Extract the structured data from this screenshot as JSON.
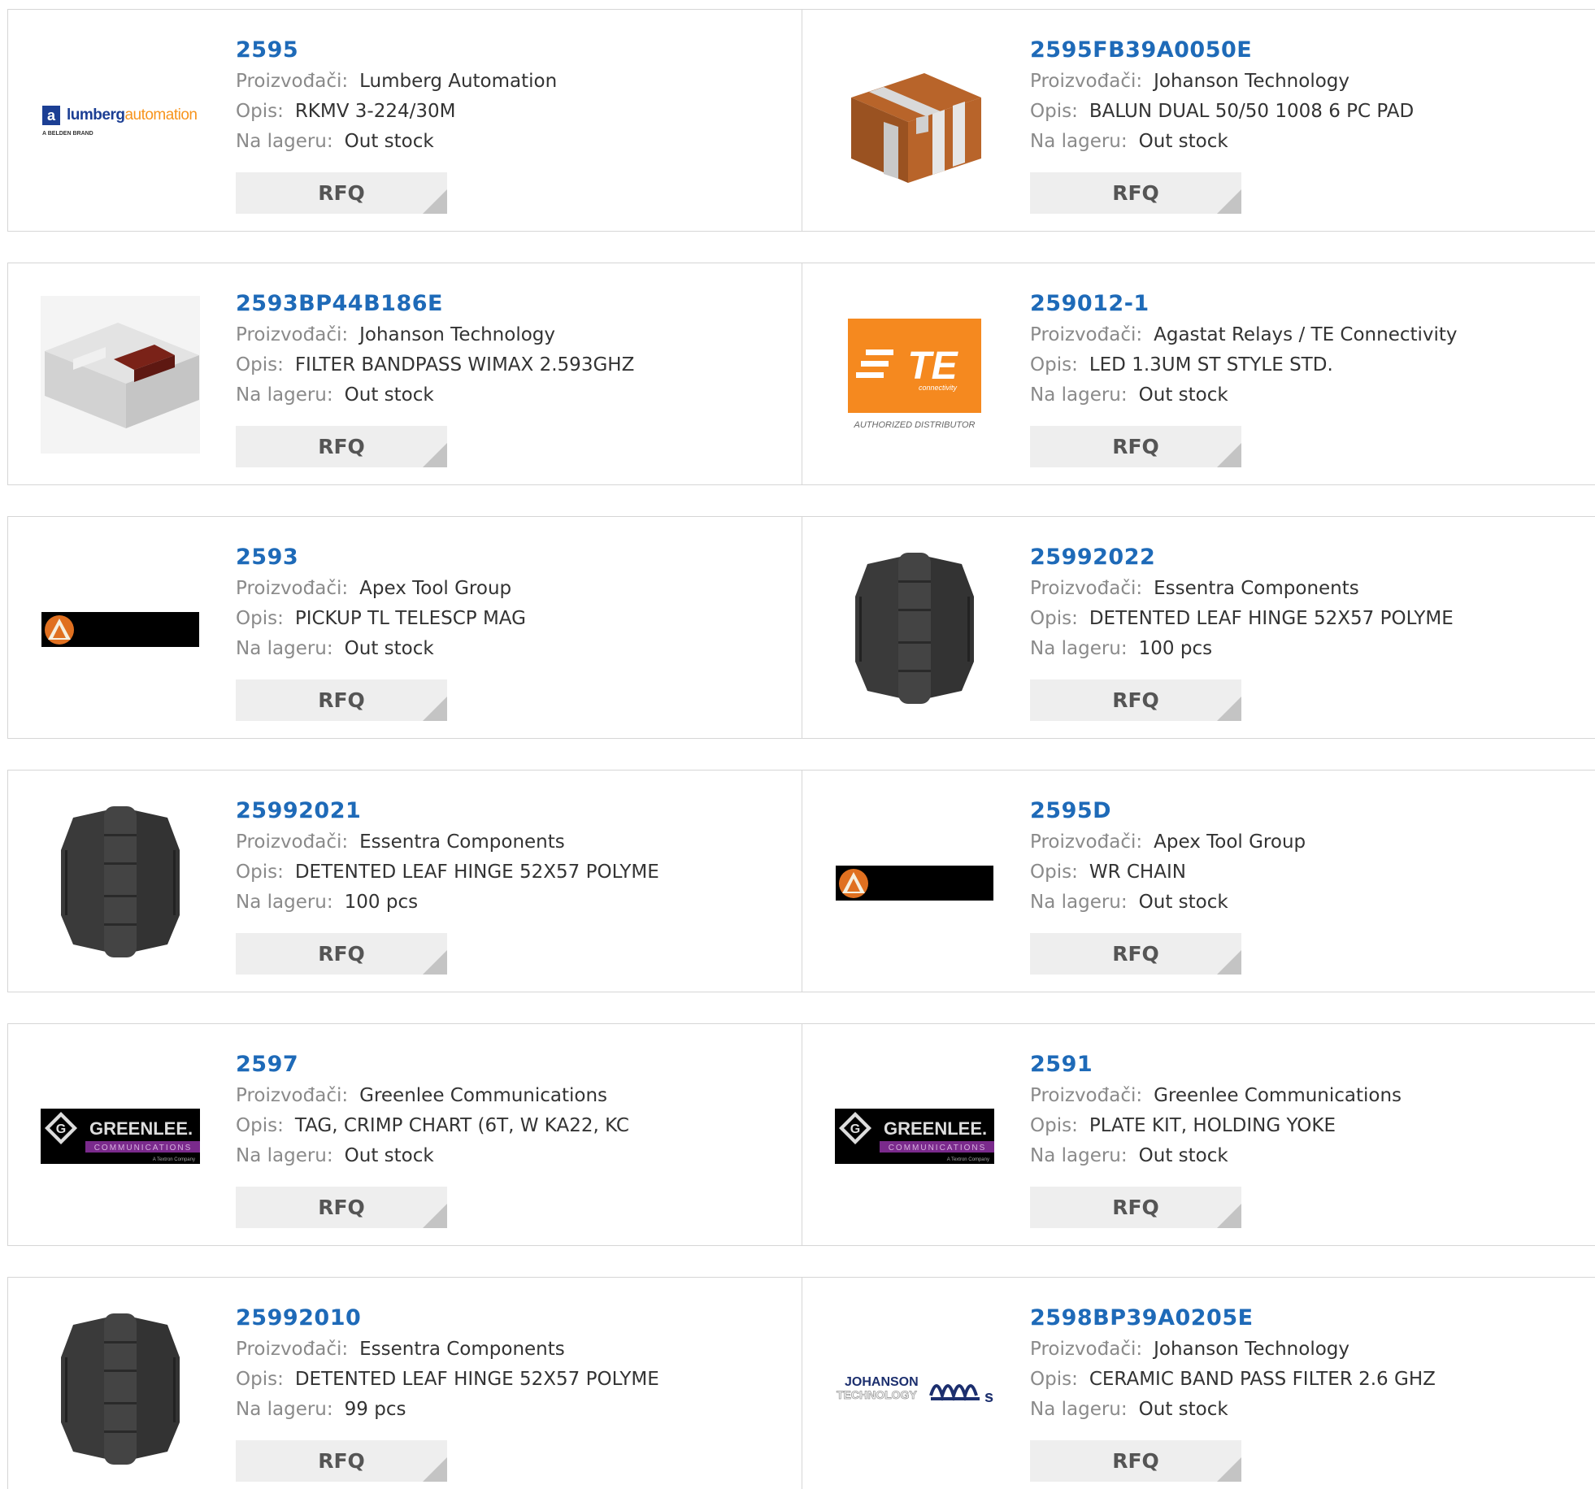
{
  "labels": {
    "manufacturer": "Proizvođači:",
    "description": "Opis:",
    "stock": "Na lageru:",
    "rfq": "RFQ"
  },
  "brand_logos": {
    "lumberg": {
      "name": "lumberg",
      "accent": "automation",
      "sub": "A BELDEN BRAND"
    },
    "te": {
      "name": "TE",
      "sub": "connectivity",
      "tagline": "AUTHORIZED DISTRIBUTOR"
    },
    "greenlee": {
      "name": "GREENLEE.",
      "sub": "COMMUNICATIONS",
      "tagline": "A Textron Company"
    },
    "johanson": {
      "name": "JOHANSON",
      "sub": "TECHNOLOGY"
    }
  },
  "colors": {
    "link": "#1e6ab8",
    "te_orange": "#f5891f",
    "lumberg_orange": "#f7941d",
    "lumberg_blue": "#1c3f94",
    "greenlee_purple": "#7a2a8c"
  },
  "products": [
    {
      "part": "2595",
      "manufacturer": "Lumberg Automation",
      "description": "RKMV 3-224/30M",
      "stock": "Out stock",
      "image": "lumberg-logo"
    },
    {
      "part": "2595FB39A0050E",
      "manufacturer": "Johanson Technology",
      "description": "BALUN DUAL 50/50 1008 6 PC PAD",
      "stock": "Out stock",
      "image": "balun-chip"
    },
    {
      "part": "2593BP44B186E",
      "manufacturer": "Johanson Technology",
      "description": "FILTER BANDPASS WIMAX 2.593GHZ",
      "stock": "Out stock",
      "image": "filter-chip"
    },
    {
      "part": "259012-1",
      "manufacturer": "Agastat Relays / TE Connectivity",
      "description": "LED 1.3UM ST STYLE STD.",
      "stock": "Out stock",
      "image": "te-logo"
    },
    {
      "part": "2593",
      "manufacturer": "Apex Tool Group",
      "description": "PICKUP TL TELESCP MAG",
      "stock": "Out stock",
      "image": "apex-logo"
    },
    {
      "part": "25992022",
      "manufacturer": "Essentra Components",
      "description": "DETENTED LEAF HINGE 52X57 POLYME",
      "stock": "100 pcs",
      "image": "hinge"
    },
    {
      "part": "25992021",
      "manufacturer": "Essentra Components",
      "description": "DETENTED LEAF HINGE 52X57 POLYME",
      "stock": "100 pcs",
      "image": "hinge"
    },
    {
      "part": "2595D",
      "manufacturer": "Apex Tool Group",
      "description": "WR CHAIN",
      "stock": "Out stock",
      "image": "apex-logo"
    },
    {
      "part": "2597",
      "manufacturer": "Greenlee Communications",
      "description": "TAG, CRIMP CHART (6T, W KA22, KC",
      "stock": "Out stock",
      "image": "greenlee-logo"
    },
    {
      "part": "2591",
      "manufacturer": "Greenlee Communications",
      "description": "PLATE KIT, HOLDING YOKE",
      "stock": "Out stock",
      "image": "greenlee-logo"
    },
    {
      "part": "25992010",
      "manufacturer": "Essentra Components",
      "description": "DETENTED LEAF HINGE 52X57 POLYME",
      "stock": "99 pcs",
      "image": "hinge"
    },
    {
      "part": "2598BP39A0205E",
      "manufacturer": "Johanson Technology",
      "description": "CERAMIC BAND PASS FILTER 2.6 GHZ",
      "stock": "Out stock",
      "image": "johanson-logo"
    }
  ]
}
